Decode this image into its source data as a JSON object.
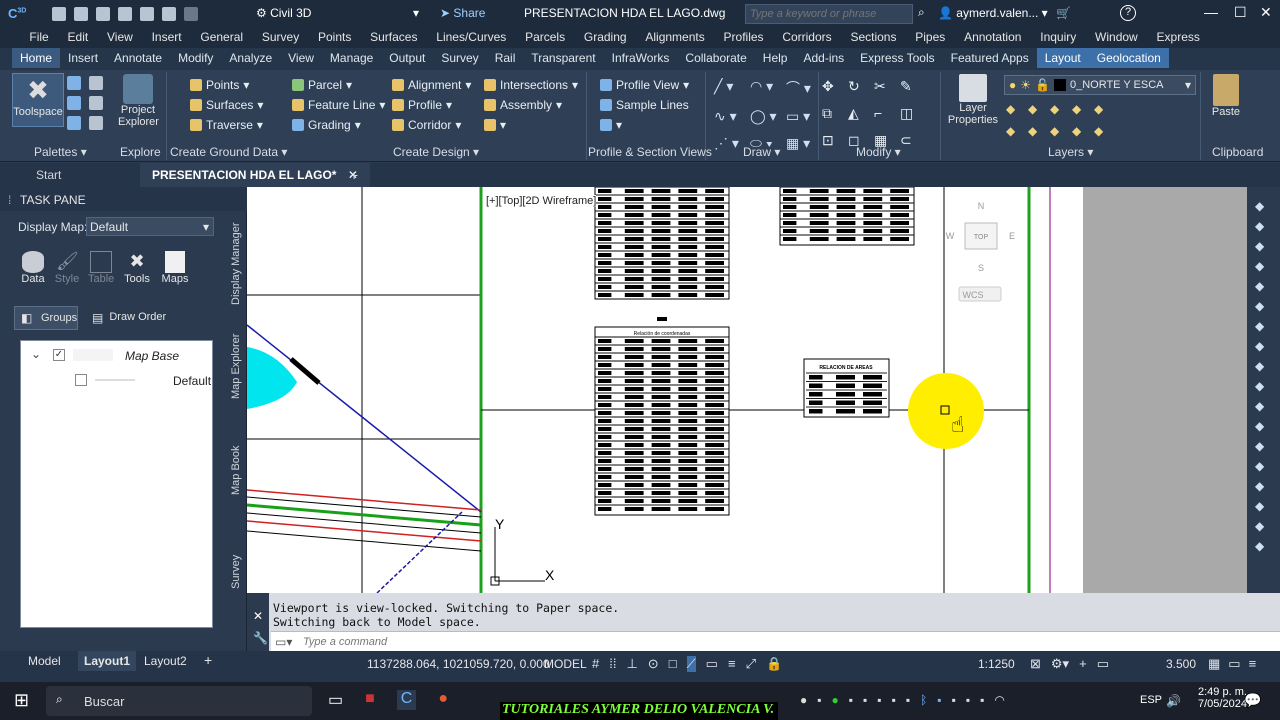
{
  "titlebar": {
    "workspace": "Civil 3D",
    "share": "Share",
    "filename": "PRESENTACION HDA EL LAGO.dwg",
    "search_placeholder": "Type a keyword or phrase",
    "user": "aymerd.valen...",
    "help": "?"
  },
  "menubar": [
    "File",
    "Edit",
    "View",
    "Insert",
    "General",
    "Survey",
    "Points",
    "Surfaces",
    "Lines/Curves",
    "Parcels",
    "Grading",
    "Alignments",
    "Profiles",
    "Corridors",
    "Sections",
    "Pipes",
    "Annotation",
    "Inquiry",
    "Window",
    "Express"
  ],
  "ribbon_tabs": [
    "Home",
    "Insert",
    "Annotate",
    "Modify",
    "Analyze",
    "View",
    "Manage",
    "Output",
    "Survey",
    "Rail",
    "Transparent",
    "InfraWorks",
    "Collaborate",
    "Help",
    "Add-ins",
    "Express Tools",
    "Featured Apps",
    "Layout",
    "Geolocation"
  ],
  "ribbon": {
    "toolspace": "Toolspace",
    "project_explorer_1": "Project",
    "project_explorer_2": "Explorer",
    "points": "Points",
    "surfaces": "Surfaces",
    "traverse": "Traverse",
    "parcel": "Parcel",
    "feature_line": "Feature Line",
    "grading": "Grading",
    "alignment": "Alignment",
    "profile": "Profile",
    "corridor": "Corridor",
    "intersections": "Intersections",
    "assembly": "Assembly",
    "profile_view": "Profile View",
    "sample_lines": "Sample Lines",
    "layer_properties_1": "Layer",
    "layer_properties_2": "Properties",
    "layer_name": "0_NORTE Y ESCA",
    "paste": "Paste",
    "groups": {
      "palettes": "Palettes",
      "explore": "Explore",
      "create_ground": "Create Ground Data",
      "create_design": "Create Design",
      "profile_section": "Profile & Section Views",
      "draw": "Draw",
      "modify": "Modify",
      "layers": "Layers",
      "clipboard": "Clipboard"
    }
  },
  "doctabs": {
    "start": "Start",
    "active": "PRESENTACION HDA EL LAGO*"
  },
  "taskpane": {
    "title": "TASK PANE",
    "display_map_label": "Display Map:",
    "display_map_value": "Default",
    "tools": [
      "Data",
      "Style",
      "Table",
      "Tools",
      "Maps"
    ],
    "groups": "Groups",
    "draw_order": "Draw Order",
    "tree": {
      "map_base": "Map Base",
      "default": "Default"
    },
    "side_tabs": [
      "Display Manager",
      "Map Explorer",
      "Map Book",
      "Survey"
    ]
  },
  "canvas": {
    "viewport_label": "[+][Top][2D Wireframe]",
    "viewcube_top": "TOP",
    "viewcube_n": "N",
    "viewcube_s": "S",
    "viewcube_w": "W",
    "viewcube_e": "E",
    "wcs": "WCS",
    "table_title": "Relación de coordenadas",
    "areas_title": "RELACION DE AREAS",
    "ucs_y": "Y",
    "ucs_x": "X"
  },
  "command": {
    "line1": "Viewport is view-locked. Switching to Paper space.",
    "line2": "Switching back to Model space.",
    "placeholder": "Type a command"
  },
  "statusbar": {
    "tabs": [
      "Model",
      "Layout1",
      "Layout2"
    ],
    "coords": "1137288.064, 1021059.720, 0.000",
    "mode": "MODEL",
    "scale": "1:1250",
    "annot": "3.500"
  },
  "taskbar": {
    "search": "Buscar",
    "banner": "TUTORIALES AYMER DELIO VALENCIA V.",
    "lang": "ESP",
    "time": "2:49 p. m.",
    "date": "7/05/2024"
  }
}
